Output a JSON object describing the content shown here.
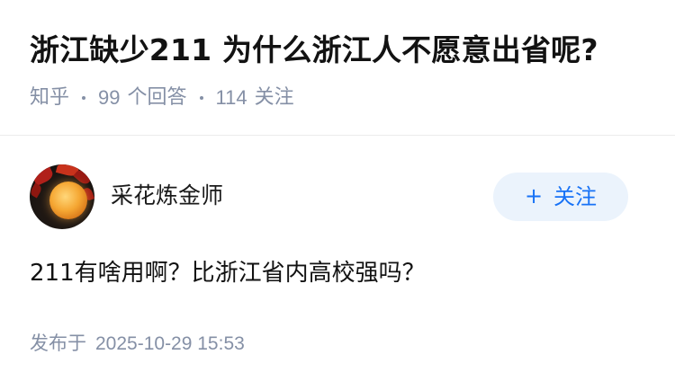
{
  "question": {
    "title": "浙江缺少211 为什么浙江人不愿意出省呢?",
    "source": "知乎",
    "answer_count": "99",
    "answer_label": "个回答",
    "follower_count": "114",
    "follower_label": "关注"
  },
  "answer": {
    "author": {
      "name": "采花炼金师",
      "avatar_icon": "avatar-moon-maple-image"
    },
    "follow_button": {
      "plus": "+",
      "label": "关注"
    },
    "content": "211有啥用啊？比浙江省内高校强吗？",
    "published_label": "发布于",
    "published_time": "2025-10-29 15:53"
  },
  "colors": {
    "primary_blue": "#1772f6",
    "button_bg": "#ebf3fc",
    "meta_gray": "#8590a6",
    "text": "#121212"
  }
}
